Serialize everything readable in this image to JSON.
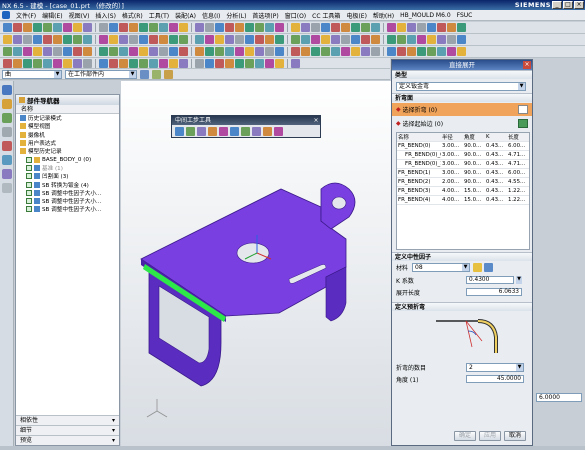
{
  "app": {
    "title": "NX 6.5 - 建模 - [case_01.prt （修改的）]",
    "brand": "SIEMENS"
  },
  "menu": [
    "文件(F)",
    "编辑(E)",
    "视图(V)",
    "插入(S)",
    "格式(R)",
    "工具(T)",
    "装配(A)",
    "信息(I)",
    "分析(L)",
    "首选项(P)",
    "窗口(O)",
    "CC 工具箱",
    "电极(E)",
    "帮助(H)",
    "HB_MOULD M6.0",
    "FSUC"
  ],
  "selection": {
    "filter": "曲",
    "scope": "在工作部件内"
  },
  "navigator": {
    "title": "部件导航器",
    "column": "名称",
    "rows": [
      {
        "label": "历史记录模式",
        "icon": "clock-icon"
      },
      {
        "label": "模型视图",
        "icon": "folder-icon"
      },
      {
        "label": "摄像机",
        "icon": "camera-icon"
      },
      {
        "label": "用户表达式",
        "icon": "folder-icon"
      },
      {
        "label": "模型历史记录",
        "icon": "folder-icon"
      },
      {
        "label": "BASE_BODY_0 (0)",
        "icon": "body-icon"
      },
      {
        "label": "基准 (1)",
        "icon": "datum-icon"
      },
      {
        "label": "凹割面 (3)",
        "icon": "cut-icon"
      },
      {
        "label": "SB 转换为钣金 (4)",
        "icon": "sheet-icon"
      },
      {
        "label": "SB 调整中性因子大小...",
        "icon": "sheet-icon"
      },
      {
        "label": "SB 调整中性因子大小...",
        "icon": "sheet-icon"
      },
      {
        "label": "SB 调整中性因子大小...",
        "icon": "sheet-icon"
      }
    ],
    "bottom": [
      "相依性",
      "细节",
      "预览"
    ]
  },
  "floating_toolbar": {
    "title": "中间工步工具"
  },
  "dialog": {
    "title": "直接展开",
    "type_section": "类型",
    "type_value": "定义钣金弯",
    "bend_section": "折弯面",
    "select_bend": "选择折弯 (0)",
    "select_start": "选择起始边 (0)",
    "table_headers": [
      "名称",
      "半径",
      "角度",
      "K",
      "长度"
    ],
    "table_rows": [
      [
        "FR_BEND(0)",
        "3.00...",
        "90.0...",
        "0.43...",
        "6.00..."
      ],
      [
        "FR_BEND(0)_0",
        "3.00...",
        "90.0...",
        "0.43...",
        "4.71..."
      ],
      [
        "FR_BEND(0)_1",
        "3.00...",
        "90.0...",
        "0.43...",
        "4.71..."
      ],
      [
        "FR_BEND(1)",
        "3.00...",
        "90.0...",
        "0.43...",
        "6.00..."
      ],
      [
        "FR_BEND(2)",
        "2.00...",
        "90.0...",
        "0.43...",
        "4.55..."
      ],
      [
        "FR_BEND(3)",
        "4.00...",
        "15.0...",
        "0.43...",
        "1.22..."
      ],
      [
        "FR_BEND(4)",
        "4.00...",
        "15.0...",
        "0.43...",
        "1.22..."
      ]
    ],
    "neutral_section": "定义中性因子",
    "material_label": "材料",
    "material_value": "08",
    "k_label": "K 系数",
    "k_value": "0.4300",
    "length_label": "展开长度",
    "length_value": "6.0633",
    "preset_section": "定义预折弯",
    "steps_label": "折弯的数目",
    "steps_value": "2",
    "angle_label": "角度 (1)",
    "angle_value": "45.0000",
    "buttons": [
      "确定",
      "应用",
      "取消"
    ]
  },
  "right_field": "6.0000",
  "colors": {
    "part": "#7a3fe0",
    "highlight_edge": "#2ee84a",
    "dialog_highlight": "#f0a35a"
  }
}
